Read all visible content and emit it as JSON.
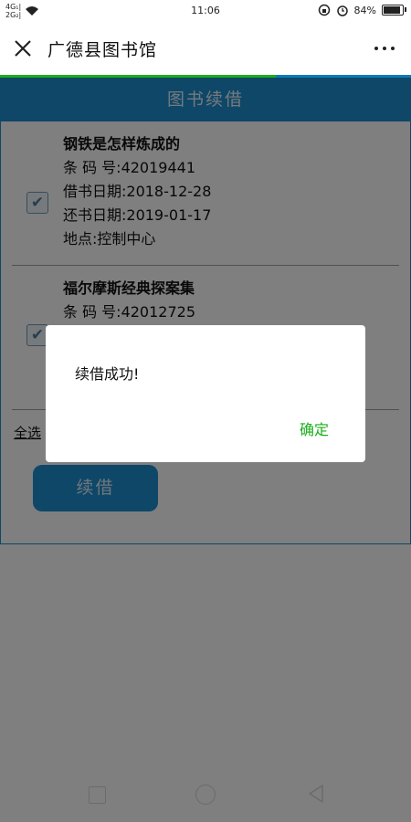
{
  "status_bar": {
    "signal_1": "4G₁|",
    "signal_2": "2G₂|",
    "time": "11:06",
    "battery": "84%"
  },
  "app_bar": {
    "title": "广德县图书馆"
  },
  "page": {
    "header": "图书续借",
    "progress": 0.67,
    "books": [
      {
        "title": "钢铁是怎样炼成的",
        "barcode": "条 码 号:42019441",
        "borrow_date": "借书日期:2018-12-28",
        "return_date": "还书日期:2019-01-17",
        "location": "地点:控制中心",
        "checked": true
      },
      {
        "title": "福尔摩斯经典探案集",
        "barcode": "条 码 号:42012725",
        "checked": true
      }
    ],
    "select_all": "全选",
    "renew_button": "续借"
  },
  "dialog": {
    "message": "续借成功!",
    "ok_button": "确定"
  },
  "colors": {
    "accent": "#1d8fd1",
    "progress": "#1aad19",
    "dialog_ok": "#1aad19"
  }
}
